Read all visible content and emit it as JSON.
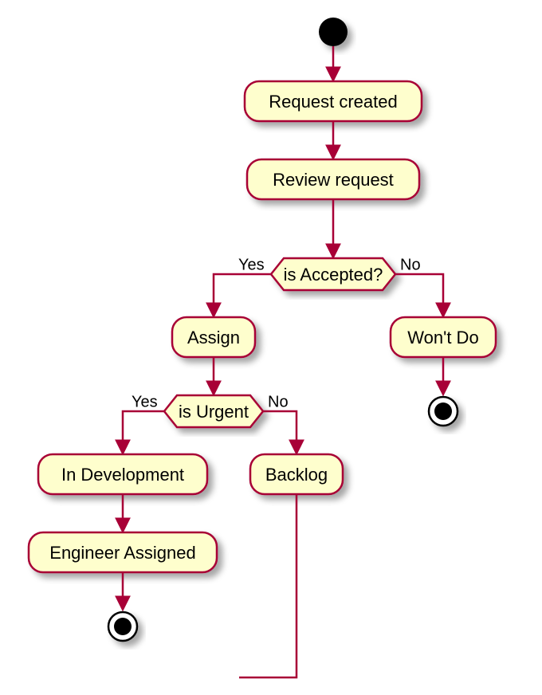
{
  "diagram": {
    "type": "activity",
    "nodes": {
      "request_created": "Request created",
      "review_request": "Review request",
      "assign": "Assign",
      "wont_do": "Won't Do",
      "in_development": "In Development",
      "backlog": "Backlog",
      "engineer_assigned": "Engineer Assigned"
    },
    "decisions": {
      "is_accepted": "is Accepted?",
      "is_urgent": "is Urgent"
    },
    "edge_labels": {
      "yes": "Yes",
      "no": "No"
    },
    "flow": [
      {
        "from": "start",
        "to": "request_created"
      },
      {
        "from": "request_created",
        "to": "review_request"
      },
      {
        "from": "review_request",
        "to": "is_accepted"
      },
      {
        "from": "is_accepted",
        "branch": "yes",
        "to": "assign"
      },
      {
        "from": "is_accepted",
        "branch": "no",
        "to": "wont_do"
      },
      {
        "from": "wont_do",
        "to": "stop"
      },
      {
        "from": "assign",
        "to": "is_urgent"
      },
      {
        "from": "is_urgent",
        "branch": "yes",
        "to": "in_development"
      },
      {
        "from": "is_urgent",
        "branch": "no",
        "to": "backlog"
      },
      {
        "from": "in_development",
        "to": "engineer_assigned"
      },
      {
        "from": "engineer_assigned",
        "to": "stop"
      },
      {
        "from": "backlog",
        "to": "merge"
      }
    ],
    "colors": {
      "node_fill": "#fefecd",
      "stroke": "#a80036"
    }
  }
}
